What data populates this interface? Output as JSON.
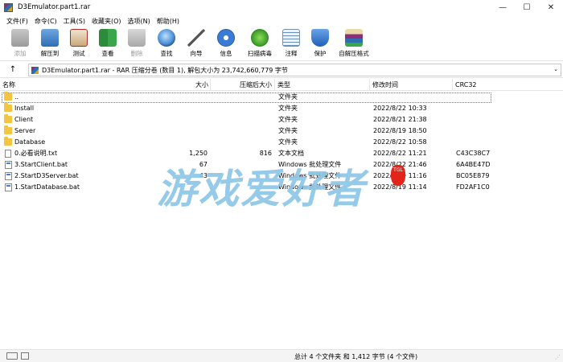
{
  "window": {
    "title": "D3Emulator.part1.rar",
    "minimize": "—",
    "maximize": "☐",
    "close": "✕"
  },
  "menu": [
    "文件(F)",
    "命令(C)",
    "工具(S)",
    "收藏夹(O)",
    "选项(N)",
    "帮助(H)"
  ],
  "toolbar": {
    "add": "添加",
    "extract": "解压到",
    "test": "测试",
    "view": "查看",
    "delete": "删除",
    "find": "查找",
    "wizard": "向导",
    "info": "信息",
    "virus": "扫描病毒",
    "comment": "注释",
    "protect": "保护",
    "sfx": "自解压格式"
  },
  "address": {
    "up": "↑",
    "path": "D3Emulator.part1.rar - RAR 压缩分卷 (数目 1), 解包大小为 23,742,660,779 字节",
    "dropdown": "⌄"
  },
  "columns": [
    "名称",
    "大小",
    "压缩后大小",
    "类型",
    "修改时间",
    "CRC32"
  ],
  "files": [
    {
      "icon": "folder",
      "name": "..",
      "size": "",
      "packed": "",
      "type": "文件夹",
      "modified": "",
      "crc": ""
    },
    {
      "icon": "folder",
      "name": "Install",
      "size": "",
      "packed": "",
      "type": "文件夹",
      "modified": "2022/8/22 10:33",
      "crc": ""
    },
    {
      "icon": "folder",
      "name": "Client",
      "size": "",
      "packed": "",
      "type": "文件夹",
      "modified": "2022/8/21 21:38",
      "crc": ""
    },
    {
      "icon": "folder",
      "name": "Server",
      "size": "",
      "packed": "",
      "type": "文件夹",
      "modified": "2022/8/19 18:50",
      "crc": ""
    },
    {
      "icon": "folder",
      "name": "Database",
      "size": "",
      "packed": "",
      "type": "文件夹",
      "modified": "2022/8/22 10:58",
      "crc": ""
    },
    {
      "icon": "txt",
      "name": "0.必看说明.txt",
      "size": "1,250",
      "packed": "816",
      "type": "文本文档",
      "modified": "2022/8/22 11:21",
      "crc": "C43C38C7"
    },
    {
      "icon": "bat",
      "name": "3.StartClient.bat",
      "size": "67",
      "packed": "",
      "type": "Windows 批处理文件",
      "modified": "2022/8/22 21:46",
      "crc": "6A4BE47D"
    },
    {
      "icon": "bat",
      "name": "2.StartD3Server.bat",
      "size": "43",
      "packed": "",
      "type": "Windows 批处理文件",
      "modified": "2022/8/19 11:16",
      "crc": "BC05E879"
    },
    {
      "icon": "bat",
      "name": "1.StartDatabase.bat",
      "size": "",
      "packed": "",
      "type": "Windows 批处理文件",
      "modified": "2022/8/19 11:14",
      "crc": "FD2AF1C0"
    }
  ],
  "status": {
    "text": "总计 4 个文件夹 和 1,412 字节 (4 个文件)"
  },
  "watermark": {
    "text": "游戏爱好者",
    "badge": "TGL"
  },
  "colors": {
    "folder": "#f5c542",
    "watermark": "#8dc6e8",
    "badge": "#e2241b"
  }
}
